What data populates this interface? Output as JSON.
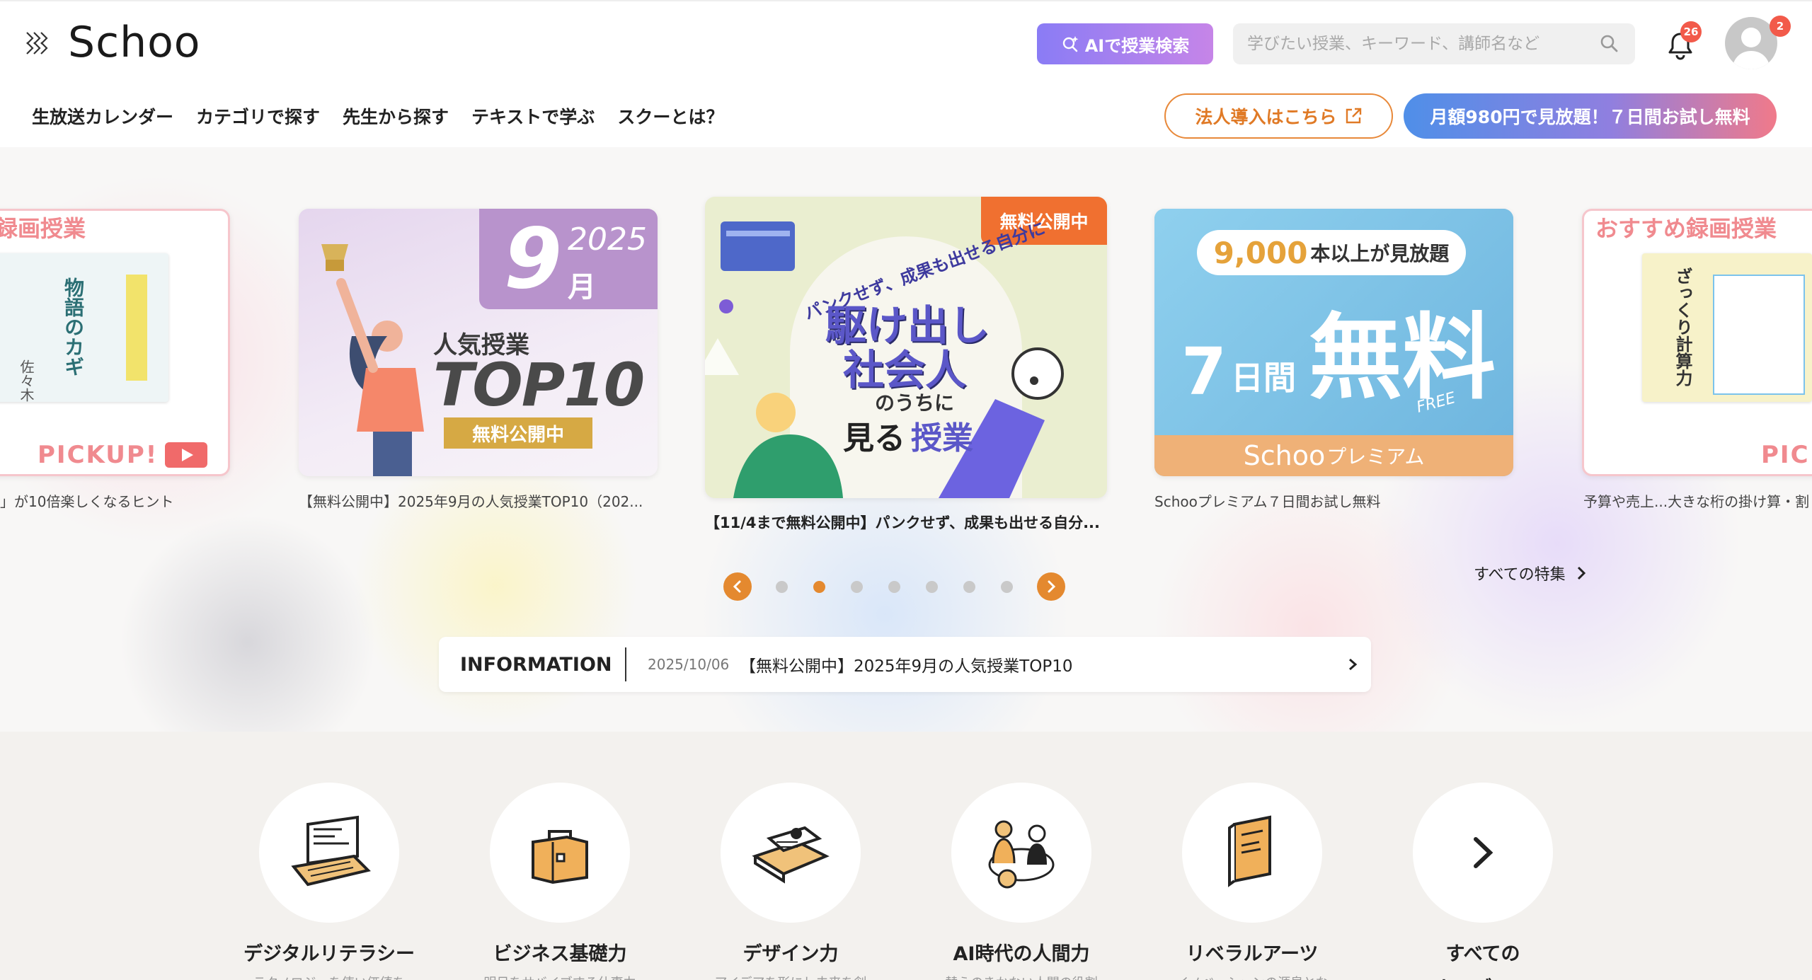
{
  "header": {
    "logo_text": "Schoo",
    "ai_search_label": "AIで授業検索",
    "search_placeholder": "学びたい授業、キーワード、講師名など",
    "notification_count": "26",
    "avatar_badge_count": "2"
  },
  "nav": {
    "links": [
      "生放送カレンダー",
      "カテゴリで探す",
      "先生から探す",
      "テキストで学ぶ",
      "スクーとは？"
    ],
    "corporate_label": "法人導入はこちら",
    "trial_label": "月額980円で見放題！７日間お試し無料"
  },
  "carousel": {
    "slides": [
      {
        "title_fragment": "録画授業",
        "label": "PICKUP!",
        "caption": "」が10倍楽しくなるヒント",
        "book": "物語のカギ",
        "author": "佐々木"
      },
      {
        "month": "9",
        "year": "2025",
        "month_unit": "月",
        "heading": "人気授業",
        "top": "TOP10",
        "ribbon": "無料公開中",
        "caption": "【無料公開中】2025年9月の人気授業TOP10（202..."
      },
      {
        "badge": "無料公開中",
        "arc": "パンクせず、成果も出せる自分に",
        "line1": "駆け出し",
        "line2": "社会人",
        "line3": "のうちに",
        "line4a": "見る",
        "line4b": "授業",
        "caption": "【11/4まで無料公開中】パンクせず、成果も出せる自分..."
      },
      {
        "count": "9,000",
        "count_suffix": "本以上が見放題",
        "days": "7",
        "days_unit": "日間",
        "free": "無料",
        "free_en": "FREE",
        "brand": "Schoo",
        "brand_suffix": "プレミアム",
        "caption": "Schooプレミアム７日間お試し無料"
      },
      {
        "title": "おすすめ録画授業",
        "label": "PIC",
        "book": "ざっくり計算力",
        "caption": "予算や売上...大きな桁の掛け算・割"
      }
    ],
    "active_index": 1,
    "dot_count": 7,
    "all_features_label": "すべての特集"
  },
  "information": {
    "label": "INFORMATION",
    "date": "2025/10/06",
    "text": "【無料公開中】2025年9月の人気授業TOP10"
  },
  "categories": [
    {
      "name": "デジタルリテラシー",
      "desc": "テクノロジーを使い価値を",
      "icon": "laptop-icon"
    },
    {
      "name": "ビジネス基礎力",
      "desc": "明日をサバイブする仕事力",
      "icon": "briefcase-icon"
    },
    {
      "name": "デザイン力",
      "desc": "アイデアを形にし未来を創",
      "icon": "design-tablet-icon"
    },
    {
      "name": "AI時代の人間力",
      "desc": "替えのきかない人間の役割",
      "icon": "people-icon"
    },
    {
      "name": "リベラルアーツ",
      "desc": "イノベーションの源泉とな",
      "icon": "book-icon"
    },
    {
      "name": "すべての",
      "desc": "カテゴリへ",
      "icon": "chevron-right-icon"
    }
  ],
  "colors": {
    "accent_orange": "#e4892f",
    "ai_gradient_start": "#8a7cf5",
    "trial_gradient_start": "#4f8fe8",
    "badge_red": "#f25a4a"
  }
}
